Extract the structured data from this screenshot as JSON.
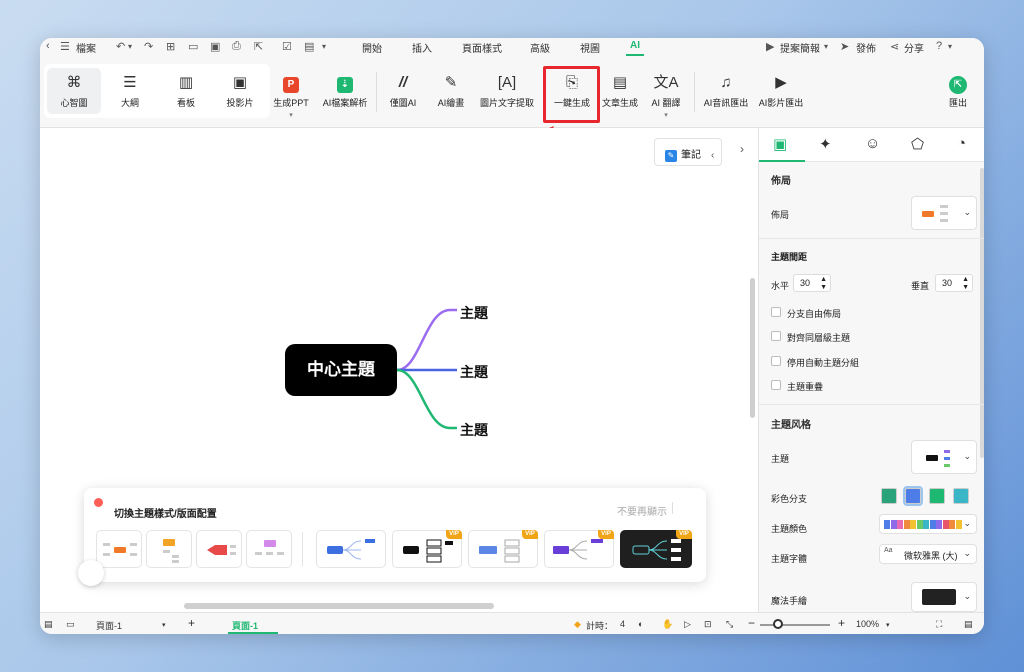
{
  "menubar": {
    "file": "檔案",
    "tabs": [
      "開始",
      "插入",
      "頁面樣式",
      "高級",
      "視圖",
      "AI"
    ],
    "feedback": "提案簡報",
    "publish": "發佈",
    "share": "分享",
    "help": "?"
  },
  "ribbon": {
    "views": [
      "心智圖",
      "大綱",
      "看板",
      "投影片"
    ],
    "ai_tools": [
      "生成PPT",
      "AI檔案解析",
      "僅圖AI",
      "AI繪畫",
      "圖片文字提取",
      "一鍵生成",
      "文章生成",
      "AI 翻譯",
      "AI音訊匯出",
      "AI影片匯出"
    ],
    "export": "匯出",
    "highlighted": "一鍵生成"
  },
  "canvas": {
    "notes_button": "筆記",
    "central_topic": "中心主題",
    "topics": [
      "主題",
      "主題",
      "主題"
    ],
    "branch_colors": [
      "#9b6cf0",
      "#4a63e0",
      "#1fb872"
    ]
  },
  "popup": {
    "title": "切換主題樣式/版面配置",
    "dont_show": "不要再顯示",
    "vip_label": "VIP"
  },
  "panel": {
    "layout_section": "佈局",
    "layout_label": "佈局",
    "spacing_section": "主題間距",
    "horizontal_label": "水平",
    "horizontal_value": "30",
    "vertical_label": "垂直",
    "vertical_value": "30",
    "checkboxes": [
      "分支自由佈局",
      "對齊同層級主題",
      "停用自動主題分組",
      "主題重疊"
    ],
    "style_section": "主題风格",
    "topic_label": "主題",
    "rainbow_label": "彩色分支",
    "color_label": "主題顏色",
    "font_label": "主題字體",
    "font_prefix": "Aa",
    "font_value": "微软雅黑 (大)",
    "magic_label": "魔法手繪",
    "palette": [
      "#4f7de8",
      "#8e6be8",
      "#e86bb5",
      "#f08a3c",
      "#f2c230",
      "#6cc96a",
      "#3bb6c7",
      "#4f7de8",
      "#8e6be8",
      "#e8556b",
      "#f08a3c",
      "#f2c230"
    ]
  },
  "status": {
    "page_current": "頁面-1",
    "page_tab": "頁面-1",
    "count_label": "計時：",
    "count_value": "4",
    "zoom": "100%"
  },
  "colors": {
    "accent": "#1fb872",
    "highlight_box": "#e8262e"
  }
}
